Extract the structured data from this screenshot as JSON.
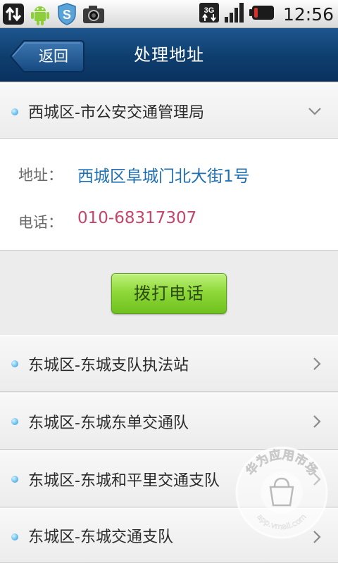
{
  "status_bar": {
    "time": "12:56",
    "icons": [
      "sync-arrows-icon",
      "android-robot-icon",
      "s-shield-icon",
      "camera-icon",
      "3g-signal-icon",
      "signal-strength-icon",
      "battery-icon"
    ],
    "network": "3G"
  },
  "header": {
    "back_label": "返回",
    "title": "处理地址"
  },
  "expanded_item": {
    "name": "西城区-市公安交通管理局",
    "address_label": "地址：",
    "address": "西城区阜城门北大街1号",
    "phone_label": "电话：",
    "phone": "010-68317307",
    "call_button": "拨打电话"
  },
  "items": [
    {
      "name": "东城区-东城支队执法站"
    },
    {
      "name": "东城区-东城东单交通队"
    },
    {
      "name": "东城区-东城和平里交通支队"
    },
    {
      "name": "东城区-东城交通支队"
    }
  ],
  "watermark": {
    "text": "华为应用市场",
    "url": "app.vmall.com"
  },
  "colors": {
    "header_bg": "#0e3e6e",
    "address_text": "#1f6fb5",
    "phone_text": "#c4466a",
    "call_button": "#8fd93a",
    "bullet": "#54b4ea"
  }
}
